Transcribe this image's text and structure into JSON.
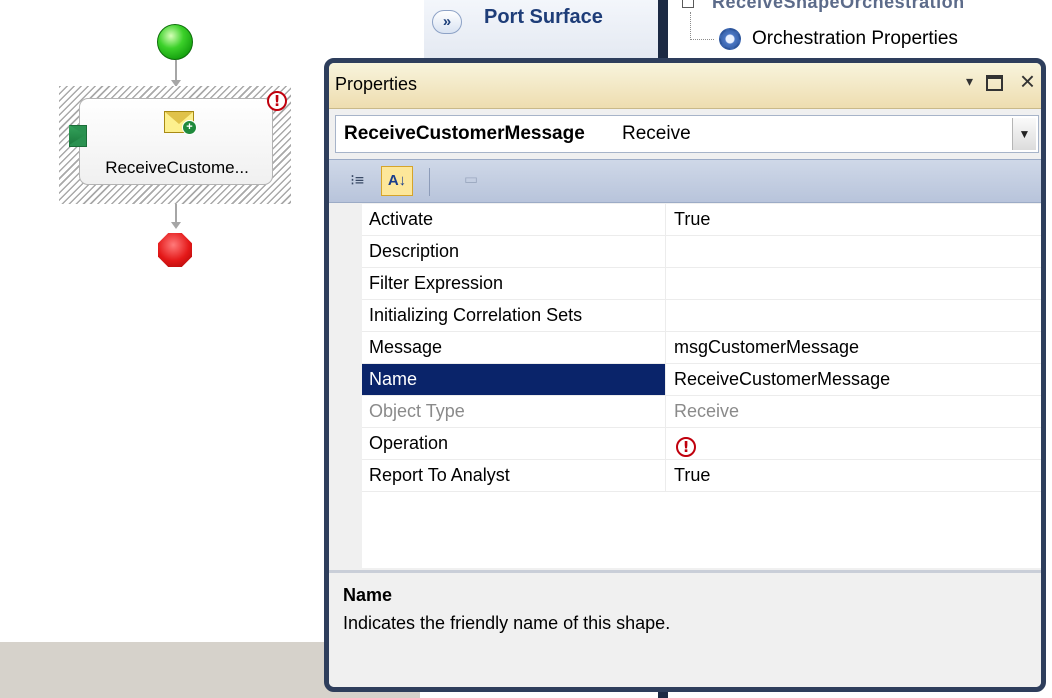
{
  "designer": {
    "shape_label": "ReceiveCustome...",
    "error_glyph": "!"
  },
  "port_surface": {
    "expand_glyph": "»",
    "label": "Port Surface"
  },
  "orchestration_view": {
    "root_label": "ReceiveShapeOrchestration",
    "properties_item": "Orchestration Properties"
  },
  "properties": {
    "title": "Properties",
    "dropdown_glyph": "▾",
    "close_glyph": "×",
    "selected_object": {
      "name": "ReceiveCustomerMessage",
      "type": "Receive"
    },
    "toolbar": {
      "categorized_glyph": "⁝≡",
      "alphabetical_glyph": "A↓",
      "property_pages_glyph": "▭"
    },
    "rows": [
      {
        "name": "Activate",
        "value": "True"
      },
      {
        "name": "Description",
        "value": ""
      },
      {
        "name": "Filter Expression",
        "value": ""
      },
      {
        "name": "Initializing Correlation Sets",
        "value": ""
      },
      {
        "name": "Message",
        "value": "msgCustomerMessage"
      },
      {
        "name": "Name",
        "value": "ReceiveCustomerMessage"
      },
      {
        "name": "Object Type",
        "value": "Receive"
      },
      {
        "name": "Operation",
        "value": ""
      },
      {
        "name": "Report To Analyst",
        "value": "True"
      }
    ],
    "description": {
      "title": "Name",
      "text": "Indicates the friendly name of this shape."
    }
  },
  "colors": {
    "selection": "#0a246a",
    "window_border": "#2e3e5c",
    "toolbar": "#c7d1e3",
    "error": "#c0000d"
  }
}
